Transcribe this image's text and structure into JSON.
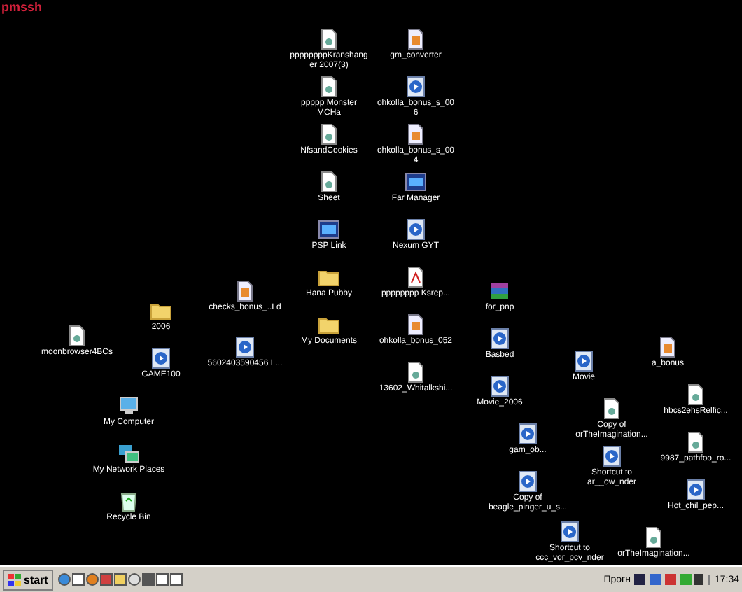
{
  "desktop_text": "pmssh",
  "icons": [
    {
      "label": "ppppppppKranshanger 2007(3)",
      "kind": "document"
    },
    {
      "label": "gm_converter",
      "kind": "image"
    },
    {
      "label": "ppppp Monster MCHa",
      "kind": "document"
    },
    {
      "label": "ohkolla_bonus_s_006",
      "kind": "media"
    },
    {
      "label": "NfsandCookies",
      "kind": "document"
    },
    {
      "label": "ohkolla_bonus_s_004",
      "kind": "image"
    },
    {
      "label": "Sheet",
      "kind": "document"
    },
    {
      "label": "Far Manager",
      "kind": "app"
    },
    {
      "label": "PSP Link",
      "kind": "app"
    },
    {
      "label": "Nexum GYT",
      "kind": "media"
    },
    {
      "label": "Hana Pubby",
      "kind": "folder"
    },
    {
      "label": "pppppppp Ksrep...",
      "kind": "pdf"
    },
    {
      "label": "checks_bonus_..Ld",
      "kind": "image"
    },
    {
      "label": "for_pnp",
      "kind": "archive"
    },
    {
      "label": "2006",
      "kind": "folder"
    },
    {
      "label": "My Documents",
      "kind": "folder"
    },
    {
      "label": "ohkolla_bonus_052",
      "kind": "image"
    },
    {
      "label": "moonbrowser4BCs",
      "kind": "document"
    },
    {
      "label": "Basbed",
      "kind": "media"
    },
    {
      "label": "5602403590456 L...",
      "kind": "media"
    },
    {
      "label": "a_bonus",
      "kind": "image"
    },
    {
      "label": "GAME100",
      "kind": "media"
    },
    {
      "label": "Movie",
      "kind": "media"
    },
    {
      "label": "13602_Whitalkshi...",
      "kind": "document"
    },
    {
      "label": "Movie_2006",
      "kind": "media"
    },
    {
      "label": "hbcs2ehsRelfic...",
      "kind": "document"
    },
    {
      "label": "My Computer",
      "kind": "computer"
    },
    {
      "label": "Copy of orTheImagination...",
      "kind": "document"
    },
    {
      "label": "gam_ob...",
      "kind": "media"
    },
    {
      "label": "9987_pathfoo_ro...",
      "kind": "document"
    },
    {
      "label": "My Network Places",
      "kind": "network"
    },
    {
      "label": "Shortcut to ar__ow_nder",
      "kind": "media"
    },
    {
      "label": "Copy of beagle_pinger_u_s...",
      "kind": "media"
    },
    {
      "label": "Hot_chil_pep...",
      "kind": "media"
    },
    {
      "label": "Recycle Bin",
      "kind": "recycle"
    },
    {
      "label": "Shortcut to ccc_vor_pcv_nder",
      "kind": "media"
    },
    {
      "label": "orTheImagination...",
      "kind": "document"
    }
  ],
  "taskbar": {
    "start": "start",
    "toolbar_label": "Прогн",
    "clock": "17:34"
  }
}
